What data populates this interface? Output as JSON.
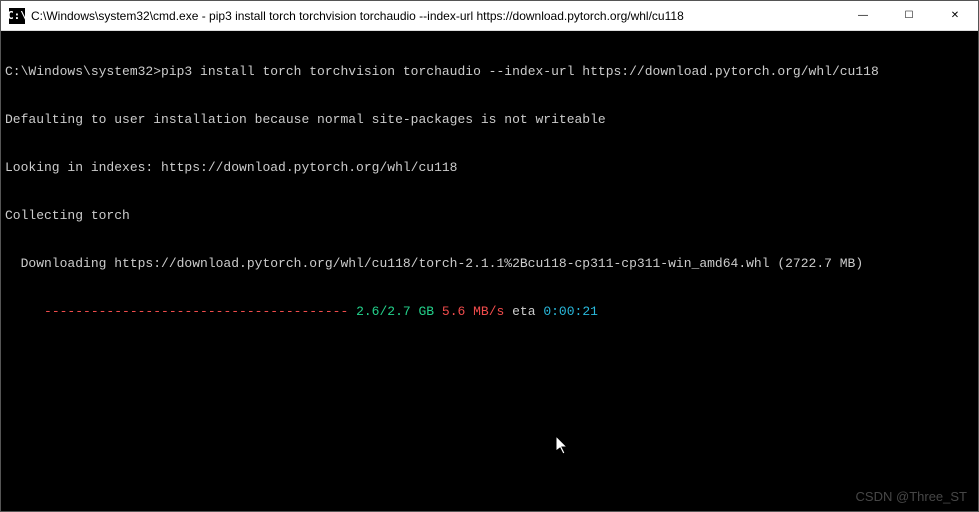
{
  "titlebar": {
    "icon_label": "cmd-icon",
    "title": "C:\\Windows\\system32\\cmd.exe - pip3  install torch torchvision torchaudio --index-url https://download.pytorch.org/whl/cu118"
  },
  "controls": {
    "minimize": "—",
    "maximize": "☐",
    "close": "✕"
  },
  "terminal": {
    "prompt": "C:\\Windows\\system32>",
    "command": "pip3 install torch torchvision torchaudio --index-url https://download.pytorch.org/whl/cu118",
    "line_default": "Defaulting to user installation because normal site-packages is not writeable",
    "line_indexes": "Looking in indexes: https://download.pytorch.org/whl/cu118",
    "line_collecting": "Collecting torch",
    "line_downloading": "  Downloading https://download.pytorch.org/whl/cu118/torch-2.1.1%2Bcu118-cp311-cp311-win_amd64.whl (2722.7 MB)",
    "progress": {
      "indent": "     ",
      "bar": "---------------------------------------",
      "spacer": " ",
      "size": "2.6/2.7 GB",
      "speed": " 5.6 MB/s",
      "eta_label": " eta ",
      "eta_value": "0:00:21"
    }
  },
  "watermark": "CSDN @Three_ST"
}
